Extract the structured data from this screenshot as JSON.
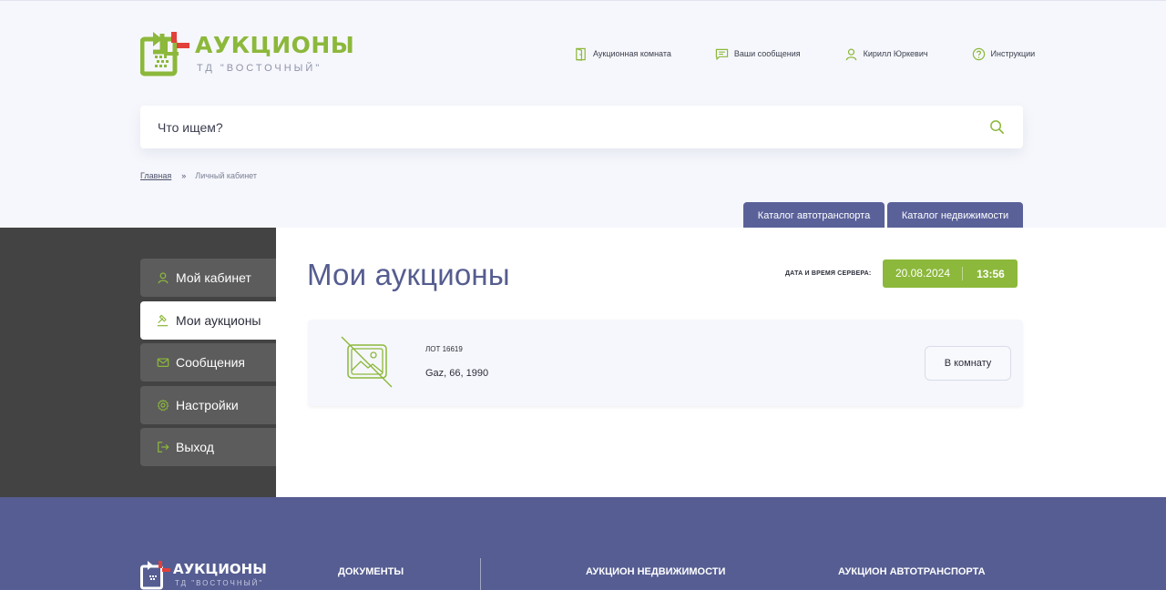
{
  "brand": {
    "title": "АУКЦИОНЫ",
    "subtitle": "ТД \"ВОСТОЧНЫЙ\"",
    "green": "#8cb83b",
    "red": "#e2403a",
    "indigo": "#555d92"
  },
  "topnav": {
    "room": {
      "label": "Аукционная комната",
      "icon": "door-icon"
    },
    "messages": {
      "label": "Ваши сообщения",
      "icon": "chat-icon"
    },
    "user": {
      "label": "Кирилл Юркевич",
      "icon": "user-icon"
    },
    "help": {
      "label": "Инструкции",
      "icon": "help-icon"
    }
  },
  "search": {
    "placeholder": "Что ищем?",
    "icon": "search-icon"
  },
  "breadcrumb": {
    "home": "Главная",
    "separator": "»",
    "current": "Личный кабинет"
  },
  "catalog_tabs": [
    "Каталог автотранспорта",
    "Каталог недвижимости"
  ],
  "sidebar": {
    "items": [
      {
        "label": "Мой кабинет",
        "icon": "user-icon",
        "active": false
      },
      {
        "label": "Мои аукционы",
        "icon": "gavel-icon",
        "active": true
      },
      {
        "label": "Сообщения",
        "icon": "mail-icon",
        "active": false
      },
      {
        "label": "Настройки",
        "icon": "gear-icon",
        "active": false
      },
      {
        "label": "Выход",
        "icon": "logout-icon",
        "active": false
      }
    ]
  },
  "main": {
    "title": "Мои аукционы",
    "server": {
      "label": "ДАТА И ВРЕМЯ СЕРВЕРА:",
      "date": "20.08.2024",
      "time": "13:56"
    },
    "lots": [
      {
        "number": "ЛОТ 16619",
        "name": "Gaz, 66, 1990",
        "button": "В комнату",
        "image": "no-image-icon"
      }
    ]
  },
  "footer": {
    "logo_title": "АУКЦИОНЫ",
    "logo_subtitle": "ТД \"ВОСТОЧНЫЙ\"",
    "headings": [
      "ДОКУМЕНТЫ",
      "АУКЦИОН НЕДВИЖИМОСТИ",
      "АУКЦИОН АВТОТРАНСПОРТА"
    ]
  }
}
